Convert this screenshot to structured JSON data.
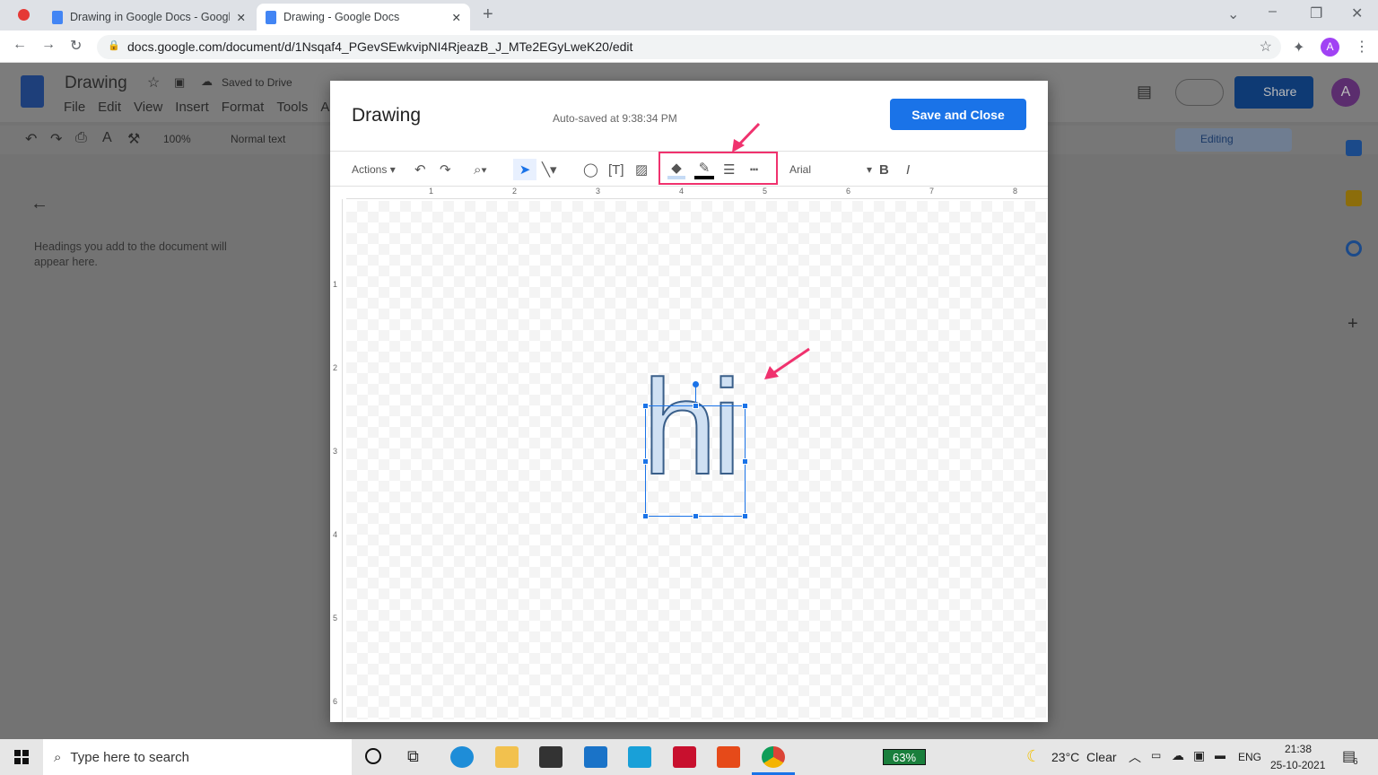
{
  "browser": {
    "tabs": [
      {
        "title": "Drawing in Google Docs - Googl"
      },
      {
        "title": "Drawing - Google Docs"
      }
    ],
    "url": "docs.google.com/document/d/1Nsqaf4_PGevSEwkvipNI4RjeazB_J_MTe2EGyLweK20/edit",
    "profile": "A"
  },
  "docs": {
    "title": "Drawing",
    "saved": "Saved to Drive",
    "menu": [
      "File",
      "Edit",
      "View",
      "Insert",
      "Format",
      "Tools",
      "Ad"
    ],
    "zoom": "100%",
    "style": "Normal text",
    "outline_hint": "Headings you add to the document will appear here.",
    "share": "Share",
    "mode": "Editing",
    "avatar": "A"
  },
  "dialog": {
    "title": "Drawing",
    "autosave": "Auto-saved at 9:38:34 PM",
    "save_close": "Save and Close",
    "actions": "Actions",
    "font": "Arial",
    "bold": "B",
    "italic": "I",
    "ruler": [
      "1",
      "2",
      "3",
      "4",
      "5",
      "6",
      "7",
      "8"
    ],
    "vruler": [
      "1",
      "2",
      "3",
      "4",
      "5",
      "6"
    ],
    "shape_text": "hi"
  },
  "taskbar": {
    "search": "Type here to search",
    "battery": "63%",
    "weather": "23°C  Clear",
    "lang": "ENG",
    "time": "21:38",
    "date": "25-10-2021",
    "notif": "6"
  },
  "colors": {
    "accent": "#1a73e8",
    "highlight": "#f0326e"
  }
}
